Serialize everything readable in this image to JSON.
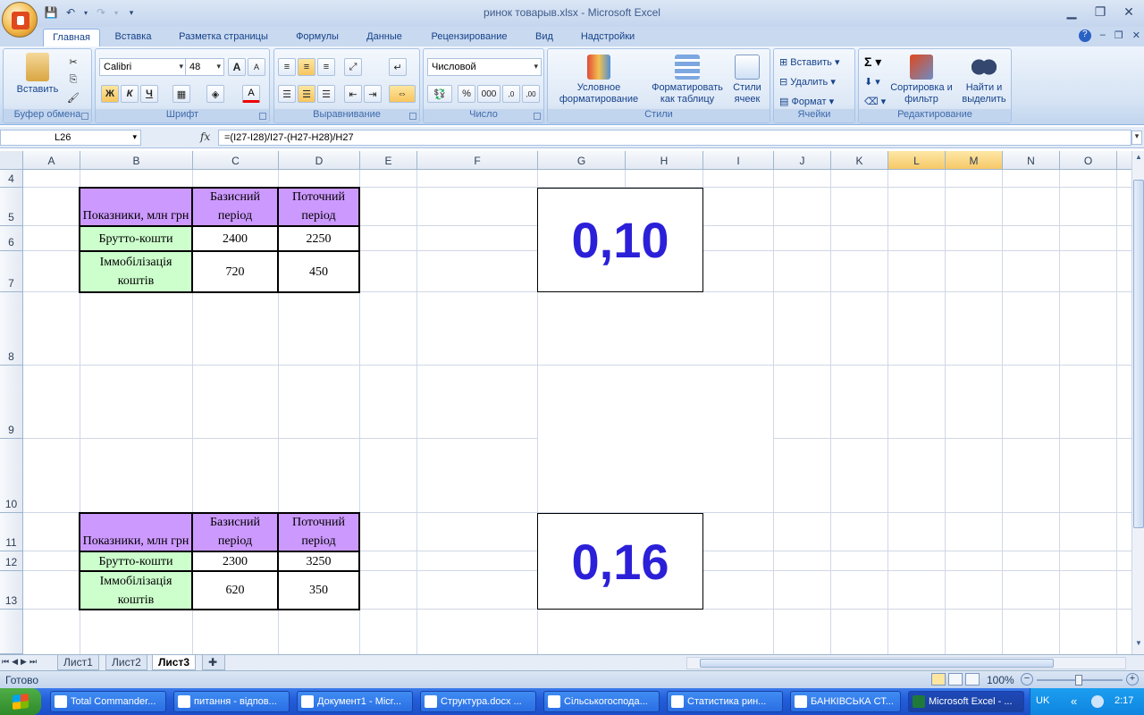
{
  "window": {
    "title": "ринок товарыв.xlsx - Microsoft Excel"
  },
  "tabs": [
    "Главная",
    "Вставка",
    "Разметка страницы",
    "Формулы",
    "Данные",
    "Рецензирование",
    "Вид",
    "Надстройки"
  ],
  "ribbon": {
    "clipboard": {
      "label": "Буфер обмена",
      "paste": "Вставить"
    },
    "font": {
      "label": "Шрифт",
      "name": "Calibri",
      "size": "48",
      "bold": "Ж",
      "italic": "К",
      "underline": "Ч",
      "grow": "A",
      "shrink": "A"
    },
    "alignment": {
      "label": "Выравнивание"
    },
    "number": {
      "label": "Число",
      "format": "Числовой",
      "percent": "%",
      "thousands": "000"
    },
    "styles": {
      "label": "Стили",
      "conditional": "Условное форматирование",
      "as_table": "Форматировать как таблицу",
      "cell_styles": "Стили ячеек"
    },
    "cells": {
      "label": "Ячейки",
      "insert": "Вставить",
      "delete": "Удалить",
      "format": "Формат"
    },
    "editing": {
      "label": "Редактирование",
      "sort": "Сортировка и фильтр",
      "find": "Найти и выделить",
      "sum": "Σ"
    }
  },
  "formula_bar": {
    "name_box": "L26",
    "fx": "fx",
    "formula": "=(I27-I28)/I27-(H27-H28)/H27"
  },
  "columns": [
    "A",
    "B",
    "C",
    "D",
    "E",
    "F",
    "G",
    "H",
    "I",
    "J",
    "K",
    "L",
    "M",
    "N",
    "O"
  ],
  "selected_columns": [
    "L",
    "M"
  ],
  "rows": [
    "4",
    "5",
    "6",
    "7",
    "8",
    "9",
    "10",
    "11",
    "12",
    "13"
  ],
  "table1": {
    "header": [
      "Показники, млн грн",
      "Базисний період",
      "Поточний період"
    ],
    "rows": [
      [
        "Брутто-кошти",
        "2400",
        "2250"
      ],
      [
        "Іммобілізація коштів",
        "720",
        "450"
      ]
    ]
  },
  "table2": {
    "header": [
      "Показники, млн грн",
      "Базисний період",
      "Поточний період"
    ],
    "rows": [
      [
        "Брутто-кошти",
        "2300",
        "3250"
      ],
      [
        "Іммобілізація коштів",
        "620",
        "350"
      ]
    ]
  },
  "results": [
    "0,10",
    "0,16"
  ],
  "sheets": [
    "Лист1",
    "Лист2",
    "Лист3"
  ],
  "active_sheet": "Лист3",
  "status": {
    "ready": "Готово",
    "zoom": "100%"
  },
  "taskbar": {
    "items": [
      "Total Commander...",
      "питання - відпов...",
      "Документ1 - Micr...",
      "Структура.docx ...",
      "Сільськогоспода...",
      "Статистика рин...",
      "БАНКІВСЬКА СТ...",
      "Microsoft Excel - ..."
    ],
    "active": "Microsoft Excel - ...",
    "lang": "UK",
    "time": "2:17"
  }
}
